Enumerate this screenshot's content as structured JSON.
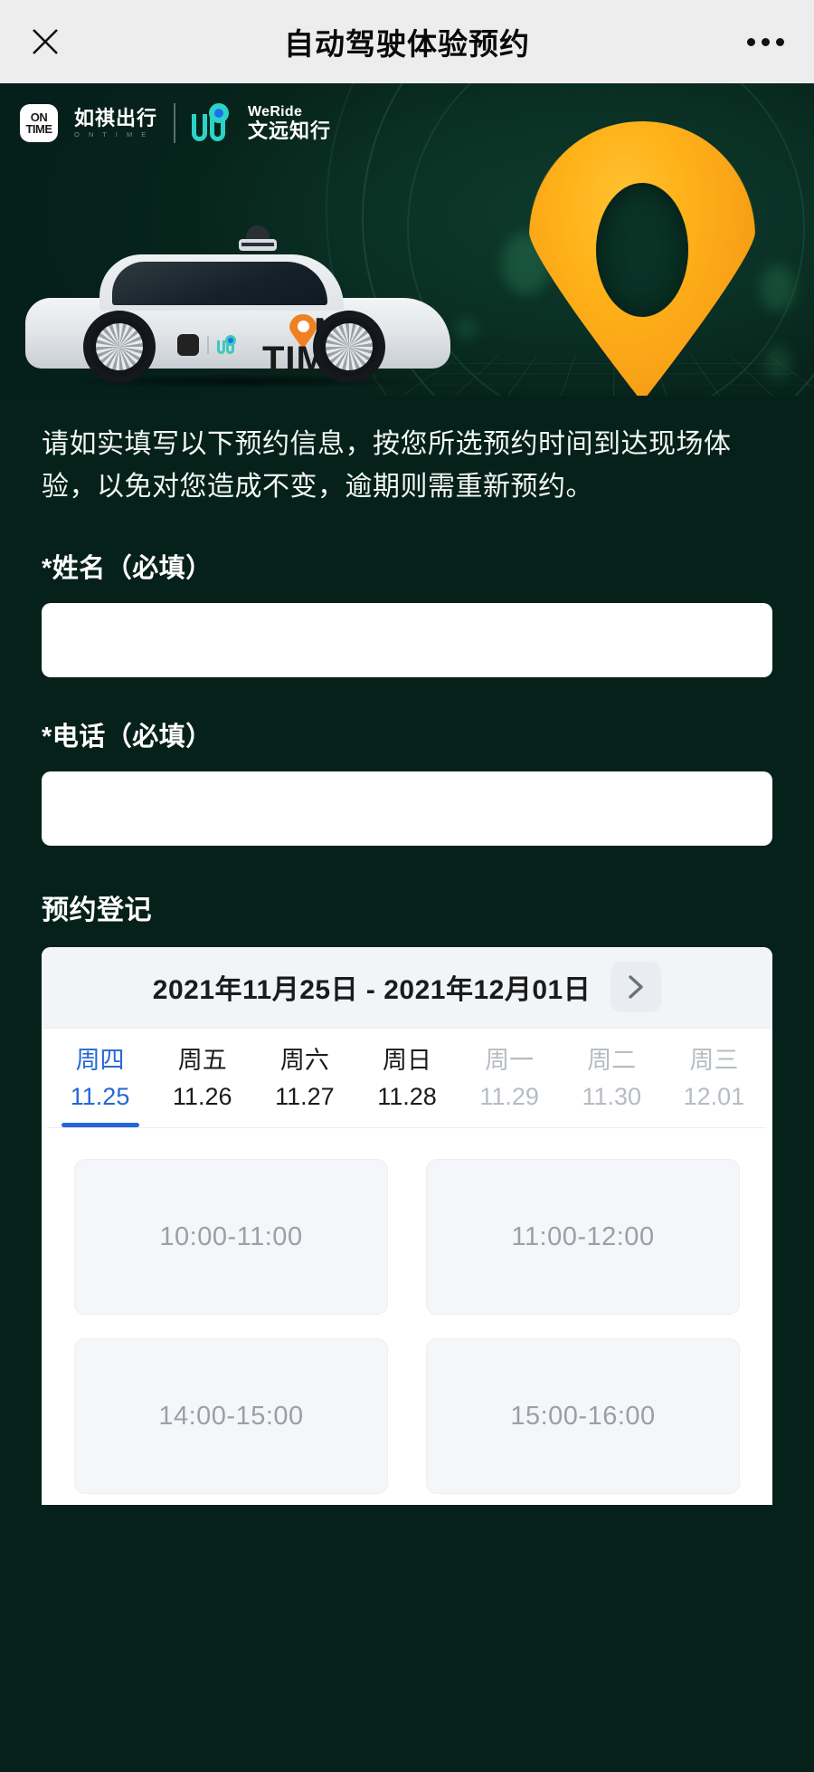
{
  "nav": {
    "close_icon": "close-icon",
    "title": "自动驾驶体验预约",
    "more_icon": "more-options-icon"
  },
  "hero": {
    "brand_left": {
      "mark_top": "ON",
      "mark_bottom": "TIME",
      "name_cn": "如祺出行",
      "name_en": "O N T I M E"
    },
    "brand_right": {
      "name_en": "WeRide",
      "name_cn": "文远知行"
    },
    "car_decal_n": "N",
    "car_decal_time": "TIME",
    "colors": {
      "background": "#06211a",
      "pin": "#ffb219",
      "weride_teal": "#2bd3c6",
      "weride_blue": "#1f6ef0",
      "ontime_orange": "#ef8122"
    }
  },
  "intro": "请如实填写以下预约信息，按您所选预约时间到达现场体验，以免对您造成不变，逾期则需重新预约。",
  "form": {
    "name_label": "*姓名（必填）",
    "name_value": "",
    "name_placeholder": "",
    "phone_label": "*电话（必填）",
    "phone_value": "",
    "phone_placeholder": ""
  },
  "booking": {
    "section_title": "预约登记",
    "date_range": "2021年11月25日 - 2021年12月01日",
    "next_icon": "chevron-right-icon",
    "days": [
      {
        "weekday": "周四",
        "date": "11.25",
        "state": "active"
      },
      {
        "weekday": "周五",
        "date": "11.26",
        "state": "normal"
      },
      {
        "weekday": "周六",
        "date": "11.27",
        "state": "normal"
      },
      {
        "weekday": "周日",
        "date": "11.28",
        "state": "normal"
      },
      {
        "weekday": "周一",
        "date": "11.29",
        "state": "muted"
      },
      {
        "weekday": "周二",
        "date": "11.30",
        "state": "muted"
      },
      {
        "weekday": "周三",
        "date": "12.01",
        "state": "muted"
      }
    ],
    "slots": [
      {
        "label": "10:00-11:00"
      },
      {
        "label": "11:00-12:00"
      },
      {
        "label": "14:00-15:00"
      },
      {
        "label": "15:00-16:00"
      }
    ],
    "active_color": "#2667d6"
  }
}
